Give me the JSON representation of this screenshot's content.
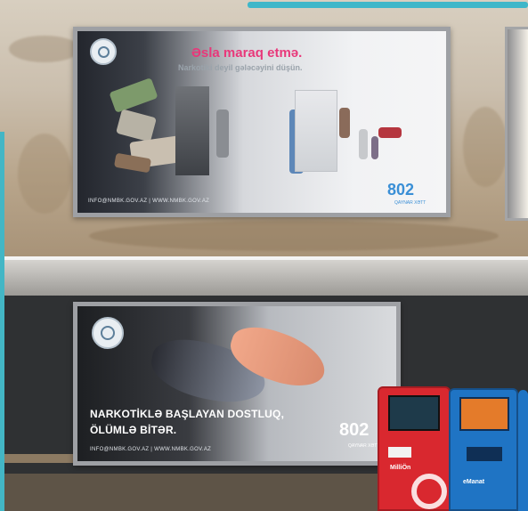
{
  "colors": {
    "accent_pink": "#e8387a",
    "hotline_blue": "#3a8fd6",
    "frame_cyan": "#3fb7c9",
    "kiosk_red": "#d9282f",
    "kiosk_blue": "#1f74c4"
  },
  "top_ad": {
    "headline": "Əsla maraq etmə.",
    "subheadline": "Narkotiki deyil gələcəyini düşün.",
    "footer": "INFO@NMBK.GOV.AZ   |   WWW.NMBK.GOV.AZ",
    "hotline_number": "802",
    "hotline_caption": "QAYNAR XƏTT"
  },
  "bottom_ad": {
    "headline_line1": "NARKOTİKLƏ BAŞLAYAN DOSTLUQ,",
    "headline_line2": "ÖLÜMLƏ BİTƏR.",
    "footer": "INFO@NMBK.GOV.AZ   |   WWW.NMBK.GOV.AZ",
    "hotline_number": "802",
    "hotline_caption": "QAYNAR XƏTT"
  },
  "kiosks": [
    {
      "color": "red",
      "brand": "MilliÖn"
    },
    {
      "color": "blue",
      "brand": "eManat"
    }
  ]
}
